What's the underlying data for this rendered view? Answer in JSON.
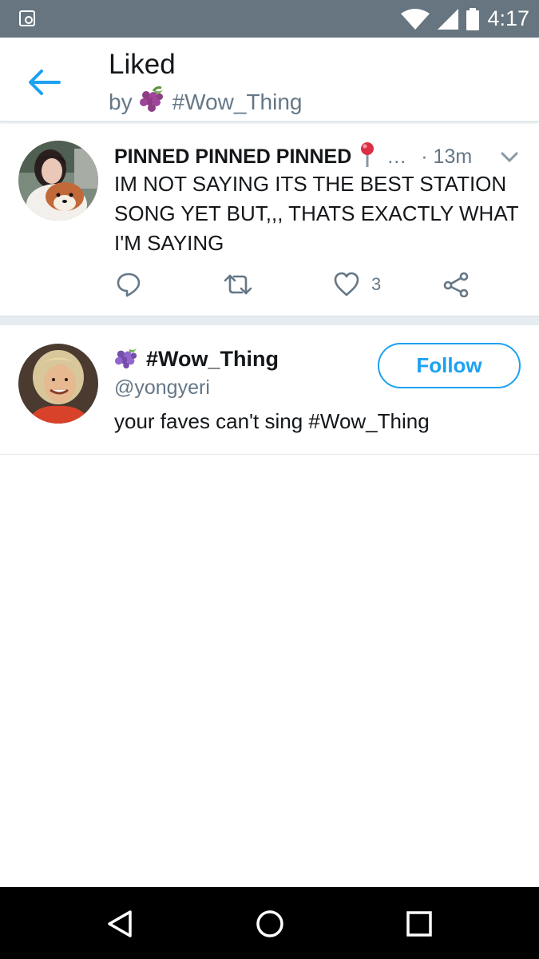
{
  "status_bar": {
    "time": "4:17",
    "icons": [
      "notification-icon",
      "wifi-icon",
      "signal-icon",
      "battery-icon"
    ]
  },
  "header": {
    "title": "Liked",
    "subtitle_prefix": "by",
    "subtitle_emoji": "grapes-emoji",
    "subtitle_name": "#Wow_Thing",
    "back_icon": "back-arrow-icon",
    "accent_color": "#1da1f2"
  },
  "tweet": {
    "author_name": "PINNED PINNED PINNED",
    "author_emoji": "round-pushpin-emoji",
    "ellipsis": "…",
    "time": "· 13m",
    "text": "IM NOT SAYING ITS THE BEST STATION SONG YET BUT,,, THATS EXACTLY WHAT I'M SAYING",
    "actions": {
      "reply_icon": "reply-icon",
      "retweet_icon": "retweet-icon",
      "like_icon": "heart-icon",
      "like_count": "3",
      "share_icon": "share-icon"
    }
  },
  "user_card": {
    "name_emoji": "grapes-emoji",
    "name": "#Wow_Thing",
    "handle": "@yongyeri",
    "bio": "your faves can't sing #Wow_Thing",
    "follow_label": "Follow"
  },
  "nav_bar": {
    "icons": [
      "back-triangle-icon",
      "home-circle-icon",
      "recents-square-icon"
    ]
  }
}
